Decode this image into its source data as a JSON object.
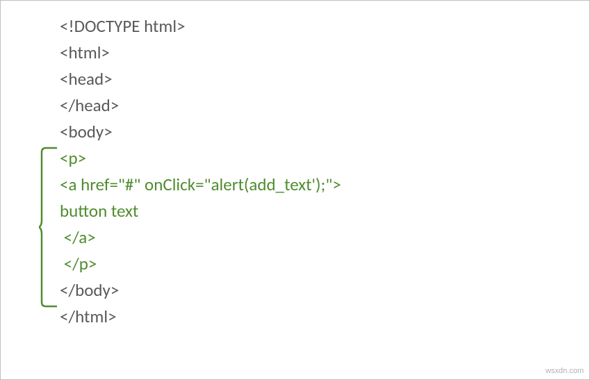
{
  "code": {
    "line1": "<!DOCTYPE html>",
    "line2": "<html>",
    "line3": "<head>",
    "line4": "</head>",
    "line5": "<body>",
    "line6": "<p>",
    "line7": "<a href=\"#\" onClick=\"alert(add_text');\">",
    "line8": "button text",
    "line9": " </a>",
    "line10": " </p>",
    "line11": "</body>",
    "line12": "</html>"
  },
  "watermark": "wsxdn.com"
}
